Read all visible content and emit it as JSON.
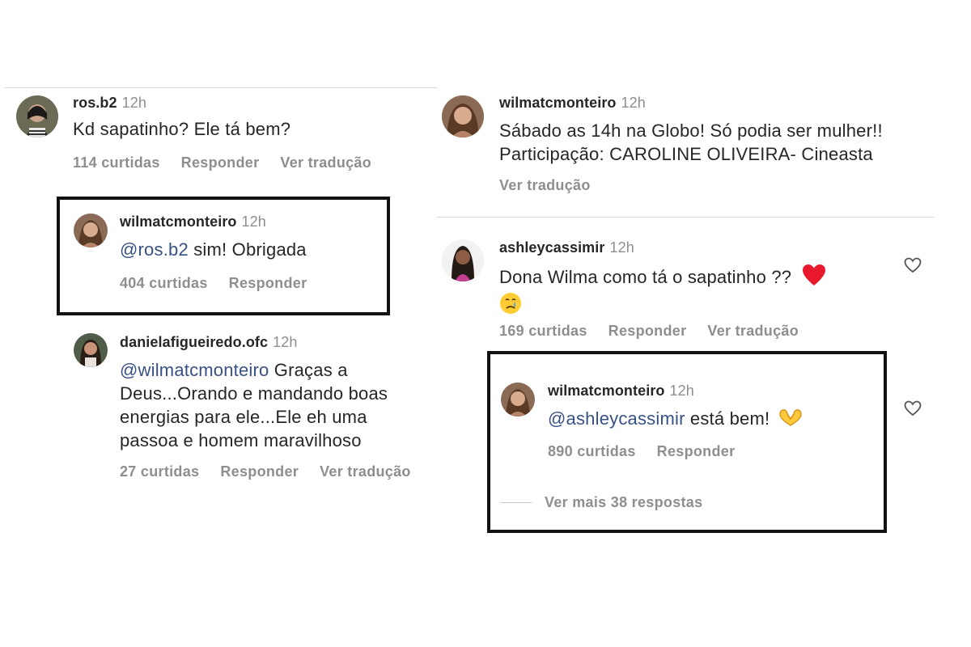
{
  "left": {
    "comment": {
      "username": "ros.b2",
      "time": "12h",
      "text": "Kd sapatinho? Ele tá bem?",
      "likes": "114 curtidas",
      "reply": "Responder",
      "translate": "Ver tradução"
    },
    "reply1": {
      "username": "wilmatcmonteiro",
      "time": "12h",
      "mention": "@ros.b2",
      "text": " sim! Obrigada",
      "likes": "404 curtidas",
      "reply": "Responder"
    },
    "reply2": {
      "username": "danielafigueiredo.ofc",
      "time": "12h",
      "mention": "@wilmatcmonteiro",
      "text_l1": " Graças a",
      "text_l2": "Deus...Orando e mandando boas",
      "text_l3": "energias para ele...Ele eh uma",
      "text_l4": "passoa e homem maravilhoso",
      "likes": "27 curtidas",
      "reply": "Responder",
      "translate": "Ver tradução"
    }
  },
  "right": {
    "post": {
      "username": "wilmatcmonteiro",
      "time": "12h",
      "line1": "Sábado as 14h na Globo! Só podia ser mulher!!",
      "line2": "Participação: CAROLINE OLIVEIRA- Cineasta",
      "translate": "Ver tradução"
    },
    "comment": {
      "username": "ashleycassimir",
      "time": "12h",
      "line1": "Dona Wilma como tá o sapatinho ??",
      "likes": "169 curtidas",
      "reply": "Responder",
      "translate": "Ver tradução"
    },
    "reply": {
      "username": "wilmatcmonteiro",
      "time": "12h",
      "mention": "@ashleycassimir",
      "text": " está bem!",
      "likes": "890 curtidas",
      "reply": "Responder",
      "view_more": "Ver mais 38 respostas"
    }
  },
  "colors": {
    "mention": "#385185",
    "secondary": "#8e8e8e",
    "primary": "#262626",
    "highlight_box": "#111111"
  },
  "icons": [
    "heart-outline-icon",
    "red-heart-emoji",
    "crying-face-emoji",
    "heart-hands-emoji"
  ]
}
